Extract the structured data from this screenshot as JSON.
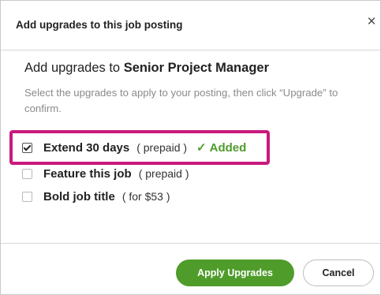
{
  "modal": {
    "title": "Add upgrades to this job posting",
    "close_label": "×"
  },
  "content": {
    "subtitle_prefix": "Add upgrades to ",
    "job_title": "Senior Project Manager",
    "description": "Select the upgrades to apply to your posting, then click “Upgrade” to confirm."
  },
  "options": [
    {
      "label": "Extend 30 days",
      "price": "( prepaid )",
      "checked": true,
      "status_check": "✓",
      "status": "Added"
    },
    {
      "label": "Feature this job",
      "price": "( prepaid )",
      "checked": false
    },
    {
      "label": "Bold job title",
      "price": "( for $53 )",
      "checked": false
    }
  ],
  "footer": {
    "apply_label": "Apply Upgrades",
    "cancel_label": "Cancel"
  },
  "colors": {
    "accent_green": "#4f9c2b",
    "highlight_magenta": "#c9197d"
  }
}
